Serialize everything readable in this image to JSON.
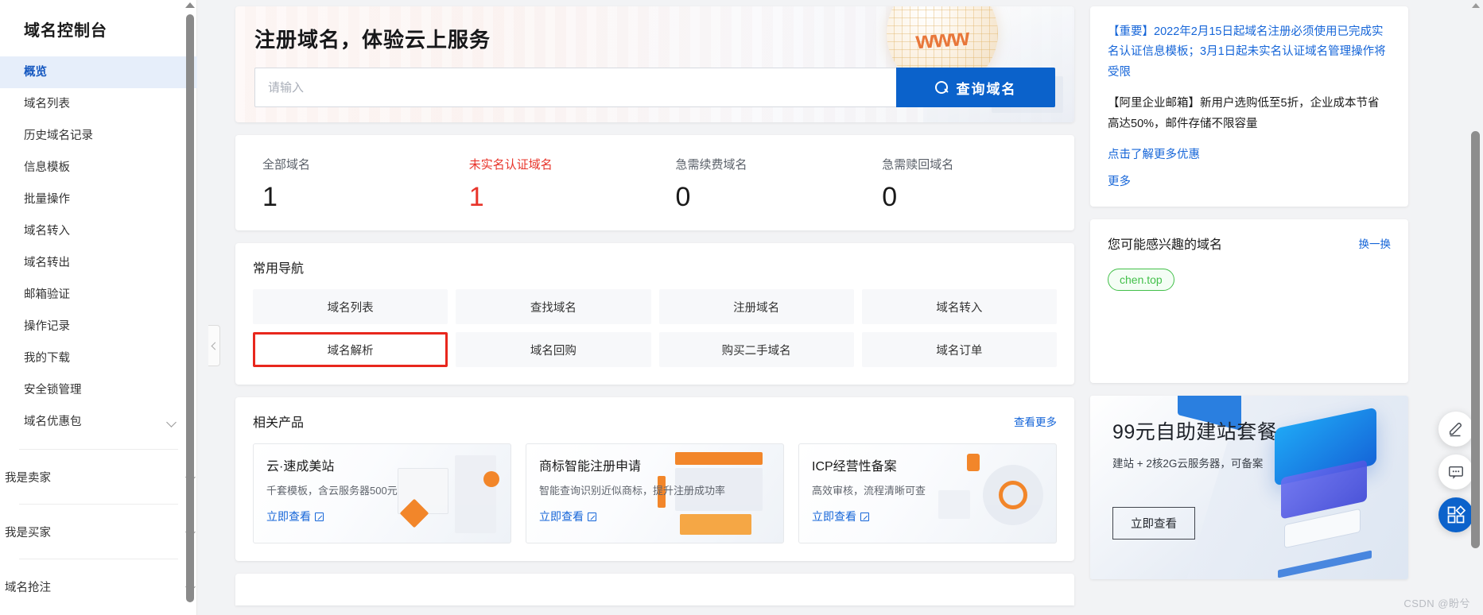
{
  "sidebar": {
    "title": "域名控制台",
    "items": [
      {
        "label": "概览",
        "active": true
      },
      {
        "label": "域名列表",
        "active": false
      },
      {
        "label": "历史域名记录",
        "active": false
      },
      {
        "label": "信息模板",
        "active": false
      },
      {
        "label": "批量操作",
        "active": false
      },
      {
        "label": "域名转入",
        "active": false
      },
      {
        "label": "域名转出",
        "active": false
      },
      {
        "label": "邮箱验证",
        "active": false
      },
      {
        "label": "操作记录",
        "active": false
      },
      {
        "label": "我的下载",
        "active": false
      },
      {
        "label": "安全锁管理",
        "active": false
      },
      {
        "label": "域名优惠包",
        "active": false,
        "expandable": true
      }
    ],
    "groups": [
      {
        "label": "我是卖家"
      },
      {
        "label": "我是买家"
      },
      {
        "label": "域名抢注"
      }
    ],
    "collapse_handle": "collapse-sidebar"
  },
  "hero": {
    "title": "注册域名，体验云上服务",
    "search_placeholder": "请输入",
    "search_value": "",
    "search_button": "查询域名",
    "globe_text": "www"
  },
  "stats": [
    {
      "label": "全部域名",
      "value": "1",
      "warn": false
    },
    {
      "label": "未实名认证域名",
      "value": "1",
      "warn": true
    },
    {
      "label": "急需续费域名",
      "value": "0",
      "warn": false
    },
    {
      "label": "急需赎回域名",
      "value": "0",
      "warn": false
    }
  ],
  "nav": {
    "title": "常用导航",
    "items": [
      {
        "label": "域名列表",
        "highlight": false
      },
      {
        "label": "查找域名",
        "highlight": false
      },
      {
        "label": "注册域名",
        "highlight": false
      },
      {
        "label": "域名转入",
        "highlight": false
      },
      {
        "label": "域名解析",
        "highlight": true
      },
      {
        "label": "域名回购",
        "highlight": false
      },
      {
        "label": "购买二手域名",
        "highlight": false
      },
      {
        "label": "域名订单",
        "highlight": false
      }
    ],
    "highlight_color": "#e8271d"
  },
  "products": {
    "title": "相关产品",
    "more_label": "查看更多",
    "items": [
      {
        "title": "云·速成美站",
        "subtitle": "千套模板，含云服务器500元",
        "link": "立即查看"
      },
      {
        "title": "商标智能注册申请",
        "subtitle": "智能查询识别近似商标，提升注册成功率",
        "link": "立即查看"
      },
      {
        "title": "ICP经营性备案",
        "subtitle": "高效审核，流程清晰可查",
        "link": "立即查看"
      }
    ]
  },
  "notice": {
    "line1": "【重要】2022年2月15日起域名注册必须使用已完成实名认证信息模板；3月1日起未实名认证域名管理操作将受限",
    "line2": "【阿里企业邮箱】新用户选购低至5折，企业成本节省高达50%，邮件存储不限容量",
    "link1": "点击了解更多优惠",
    "link2": "更多"
  },
  "interest": {
    "title": "您可能感兴趣的域名",
    "swap_label": "换一换",
    "domains": [
      "chen.top"
    ],
    "chip_color": "#43c04a"
  },
  "promo": {
    "title": "99元自助建站套餐",
    "subtitle": "建站 + 2核2G云服务器，可备案",
    "button": "立即查看"
  },
  "floats": [
    {
      "name": "feedback-pencil",
      "icon": "pencil-icon"
    },
    {
      "name": "chat",
      "icon": "chat-bubble-icon"
    },
    {
      "name": "apps",
      "icon": "apps-grid-icon"
    }
  ],
  "watermark": "CSDN @盼兮",
  "colors": {
    "accent": "#0b62cb",
    "link": "#1565d8",
    "warn": "#e8342a",
    "highlight": "#e8271d",
    "chip": "#43c04a"
  }
}
